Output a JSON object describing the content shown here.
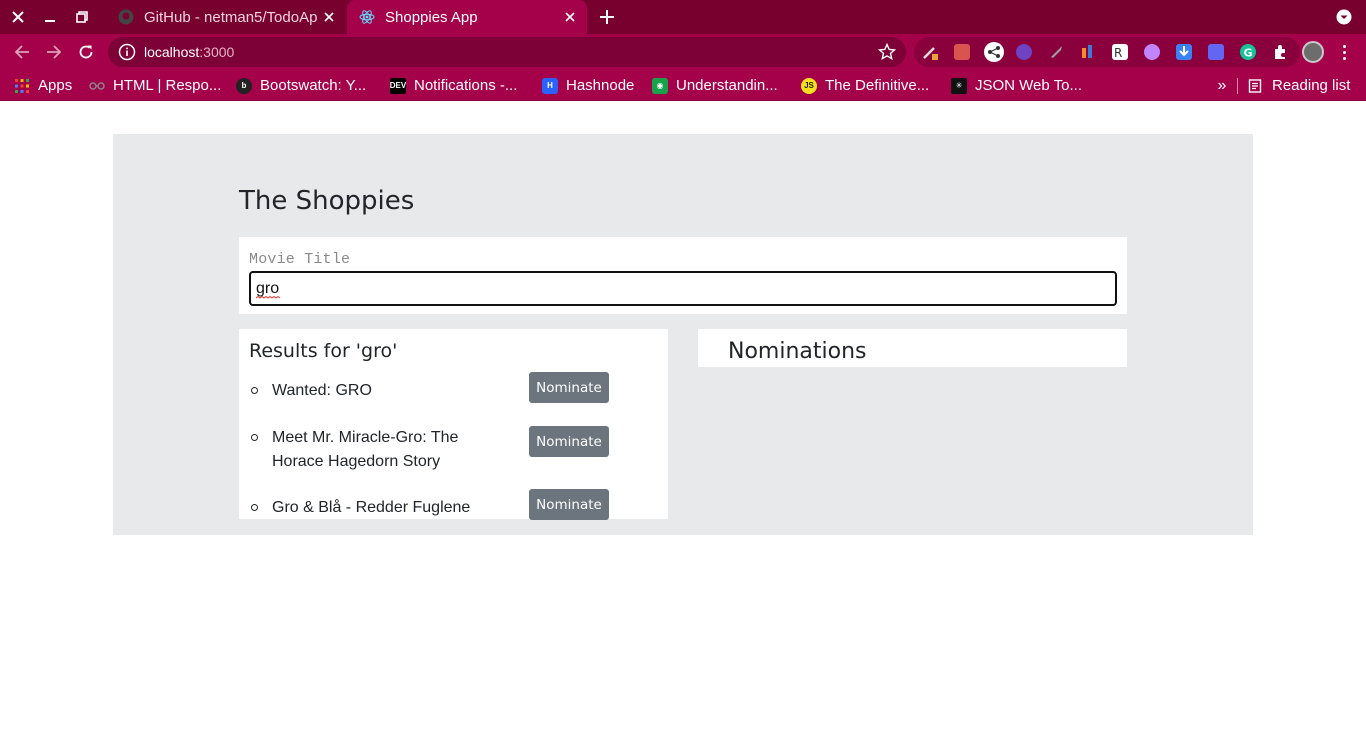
{
  "browser": {
    "tabs": [
      {
        "title": "GitHub - netman5/TodoApp",
        "active": false,
        "icon": "github-icon"
      },
      {
        "title": "Shoppies App",
        "active": true,
        "icon": "react-icon"
      }
    ],
    "url_host": "localhost",
    "url_port": ":3000",
    "bookmarks": [
      {
        "label": "Apps",
        "icon": "apps-grid-icon"
      },
      {
        "label": "HTML | Respo...",
        "icon": "glasses-icon"
      },
      {
        "label": "Bootswatch: Y...",
        "icon": "bootswatch-icon"
      },
      {
        "label": "Notifications -...",
        "icon": "dev-icon"
      },
      {
        "label": "Hashnode",
        "icon": "hashnode-icon"
      },
      {
        "label": "Understandin...",
        "icon": "green-power-icon"
      },
      {
        "label": "The Definitive...",
        "icon": "js-icon"
      },
      {
        "label": "JSON Web To...",
        "icon": "jwt-icon"
      }
    ],
    "reading_list": "Reading list",
    "more_bookmarks": "»"
  },
  "app": {
    "title": "The Shoppies",
    "search": {
      "label": "Movie Title",
      "value": "gro"
    },
    "results": {
      "heading": "Results for 'gro'",
      "nominate_label": "Nominate",
      "items": [
        {
          "title": "Wanted: GRO"
        },
        {
          "title": "Meet Mr. Miracle-Gro: The Horace Hagedorn Story"
        },
        {
          "title": "Gro & Blå - Redder Fuglene"
        }
      ]
    },
    "nominations": {
      "heading": "Nominations"
    }
  },
  "colors": {
    "tabstrip": "#78002e",
    "toolbar": "#a5004a",
    "app_background": "#e8e9eb",
    "button": "#6c757d"
  }
}
